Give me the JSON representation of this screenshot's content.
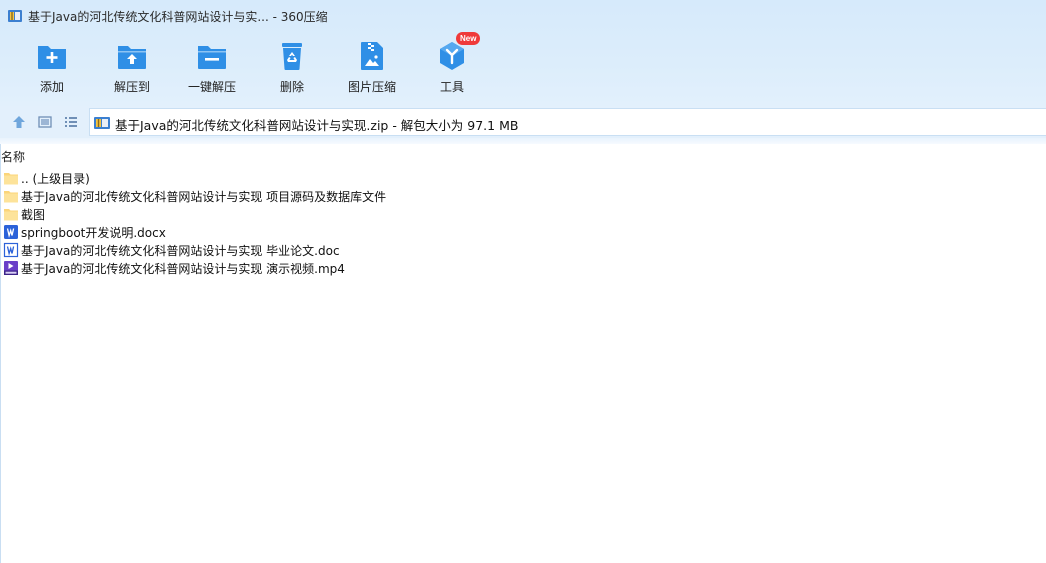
{
  "window": {
    "title": "基于Java的河北传统文化科普网站设计与实... - 360压缩"
  },
  "toolbar": {
    "items": [
      {
        "label": "添加",
        "icon": "add-folder-icon"
      },
      {
        "label": "解压到",
        "icon": "extract-to-icon"
      },
      {
        "label": "一键解压",
        "icon": "one-click-extract-icon"
      },
      {
        "label": "删除",
        "icon": "recycle-bin-icon"
      },
      {
        "label": "图片压缩",
        "icon": "image-compress-icon"
      },
      {
        "label": "工具",
        "icon": "tools-cube-icon",
        "badge": "New"
      }
    ]
  },
  "addressbar": {
    "path": "基于Java的河北传统文化科普网站设计与实现.zip - 解包大小为 97.1 MB"
  },
  "filelist": {
    "column_name": "名称",
    "rows": [
      {
        "name": ".. (上级目录)",
        "type": "folder"
      },
      {
        "name": "基于Java的河北传统文化科普网站设计与实现 项目源码及数据库文件",
        "type": "folder"
      },
      {
        "name": "截图",
        "type": "folder"
      },
      {
        "name": "springboot开发说明.docx",
        "type": "docx"
      },
      {
        "name": "基于Java的河北传统文化科普网站设计与实现 毕业论文.doc",
        "type": "doc"
      },
      {
        "name": "基于Java的河北传统文化科普网站设计与实现 演示视频.mp4",
        "type": "mp4"
      }
    ]
  },
  "colors": {
    "accent": "#2f8fe6",
    "badge": "#ef3a3a",
    "folder": "#fbd57a",
    "word": "#2b62d9"
  }
}
